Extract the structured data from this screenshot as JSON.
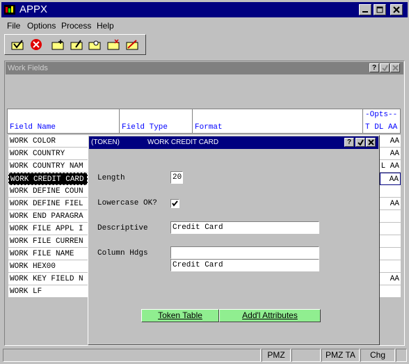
{
  "window": {
    "title": "APPX"
  },
  "menu": {
    "file": "File",
    "options": "Options",
    "process": "Process",
    "help": "Help"
  },
  "toolbar": {
    "icons": [
      "check-icon",
      "cancel-icon",
      "new-folder-icon",
      "edit-folder-icon",
      "find-folder-icon",
      "close-folder-icon",
      "delete-folder-icon"
    ]
  },
  "subwindow": {
    "title": "Work Fields",
    "help_btn": "?"
  },
  "table": {
    "headers": {
      "field_name": "Field Name",
      "field_type": "Field Type",
      "format": "Format",
      "opts": "-Opts--",
      "opts_cols": "T DL AA"
    },
    "rows": [
      {
        "name": "WORK COLOR",
        "opts": "AA"
      },
      {
        "name": "WORK COUNTRY",
        "opts": "AA"
      },
      {
        "name": "WORK COUNTRY NAM",
        "opts": "L AA"
      },
      {
        "name": "WORK CREDIT CARD",
        "opts": "AA",
        "selected": true
      },
      {
        "name": "WORK DEFINE COUN",
        "opts": ""
      },
      {
        "name": "WORK DEFINE FIEL",
        "opts": "AA"
      },
      {
        "name": "WORK END PARAGRA",
        "opts": ""
      },
      {
        "name": "WORK FILE APPL I",
        "opts": ""
      },
      {
        "name": "WORK FILE CURREN",
        "opts": ""
      },
      {
        "name": "WORK FILE NAME",
        "opts": ""
      },
      {
        "name": "WORK HEX00",
        "opts": ""
      },
      {
        "name": "WORK KEY FIELD N",
        "opts": "AA"
      },
      {
        "name": "WORK LF",
        "opts": ""
      }
    ]
  },
  "dialog": {
    "token": "(TOKEN)",
    "title": "WORK CREDIT CARD",
    "help_btn": "?",
    "length_label": "Length",
    "length_value": "20",
    "lowercase_label": "Lowercase OK?",
    "lowercase_checked": true,
    "descriptive_label": "Descriptive",
    "descriptive_value": "Credit Card",
    "column_hdgs_label": "Column Hdgs",
    "column_hdg_1": "",
    "column_hdg_2": "Credit Card",
    "token_table_btn": "Token Table",
    "add_attributes_btn": "Add'l Attributes"
  },
  "statusbar": {
    "cell1": "PMZ",
    "cell2": "PMZ TA",
    "cell3": "Chg"
  },
  "colors": {
    "titlebar": "#000080",
    "header_text": "#0000ff",
    "button_green": "#90ee90"
  }
}
